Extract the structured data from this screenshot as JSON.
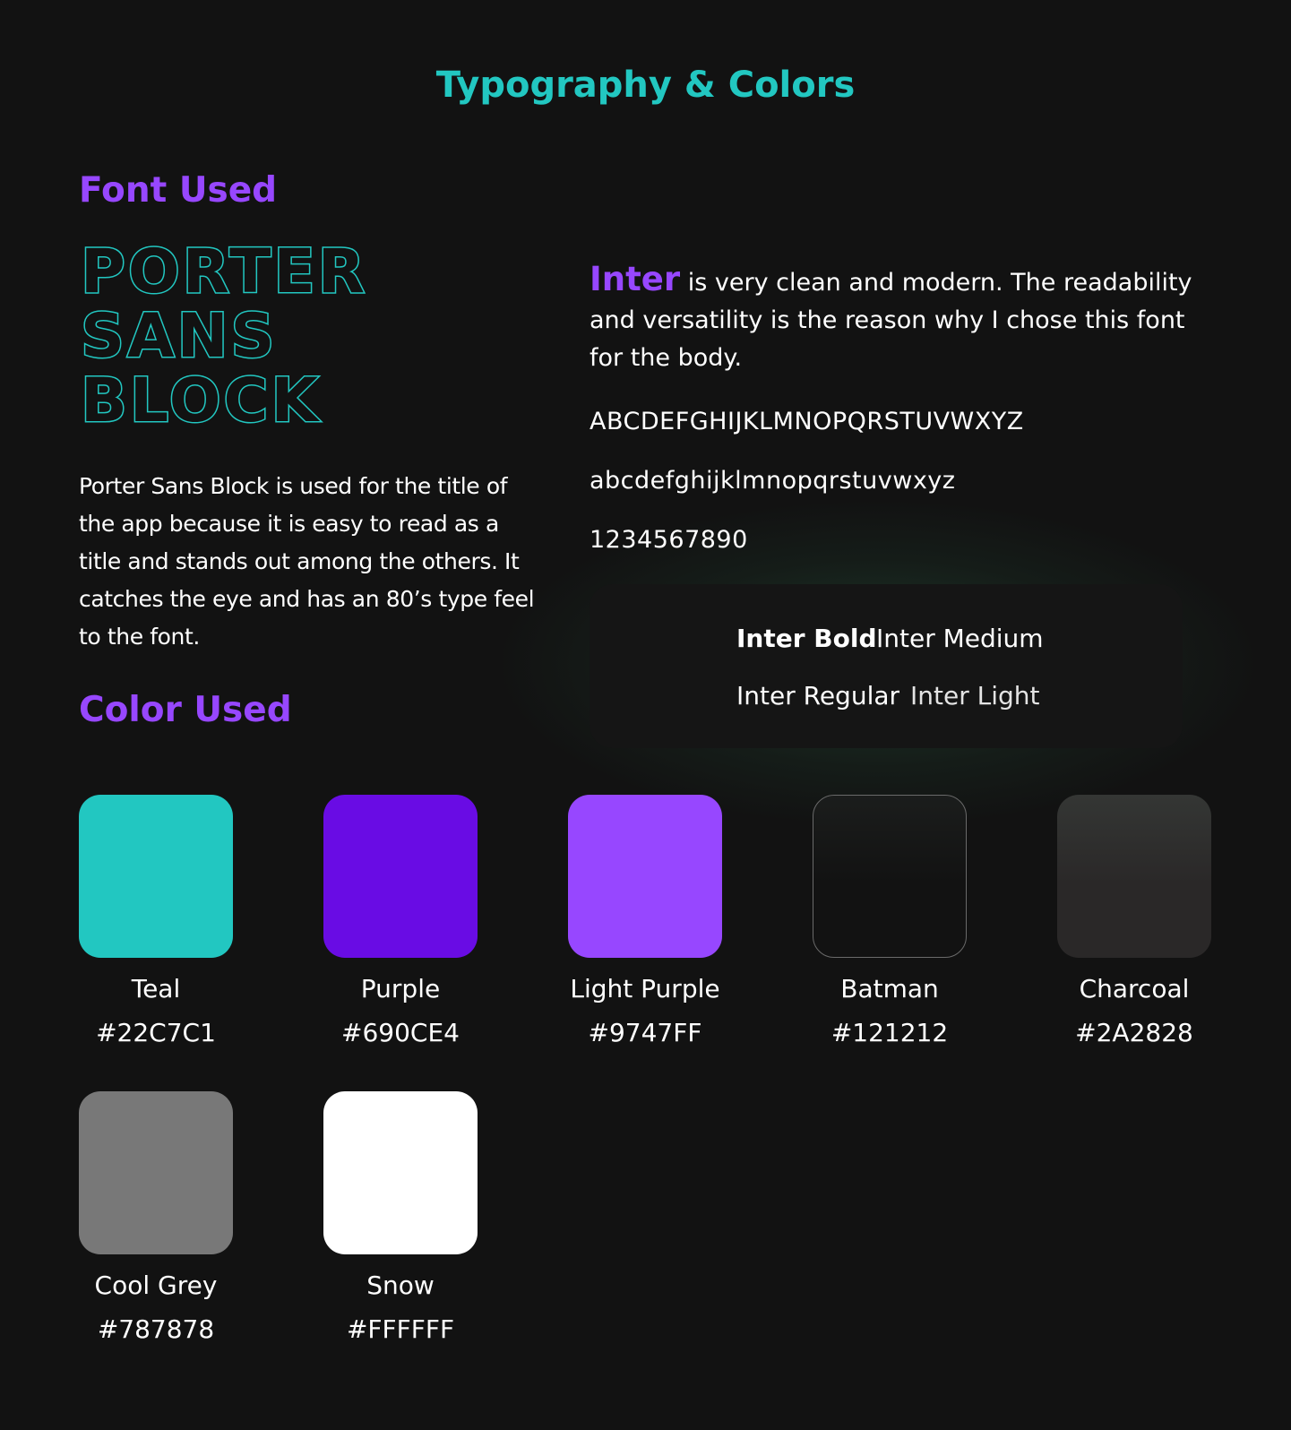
{
  "page": {
    "title": "Typography & Colors"
  },
  "font_section": {
    "heading": "Font Used",
    "display_font": {
      "lines": [
        "PORTER",
        "SANS",
        "BLOCK"
      ],
      "description": "Porter Sans Block is used for the title of the app because it is easy to read as a title and stands out among the others. It catches the eye and has an 80’s type feel to the font."
    },
    "body_font": {
      "name": "Inter",
      "description": " is very clean and modern. The readability and versatility is the reason why I chose this font for the body.",
      "uppercase": "ABCDEFGHIJKLMNOPQRSTUVWXYZ",
      "lowercase": "abcdefghijklmnopqrstuvwxyz",
      "digits": "1234567890",
      "weights": [
        "Inter Bold",
        "Inter Medium",
        "Inter Regular",
        "Inter Light"
      ]
    }
  },
  "color_section": {
    "heading": "Color Used",
    "colors": [
      {
        "name": "Teal",
        "hex": "#22C7C1"
      },
      {
        "name": "Purple",
        "hex": "#690CE4"
      },
      {
        "name": "Light Purple",
        "hex": "#9747FF"
      },
      {
        "name": "Batman",
        "hex": "#121212"
      },
      {
        "name": "Charcoal",
        "hex": "#2A2828"
      },
      {
        "name": "Cool Grey",
        "hex": "#787878"
      },
      {
        "name": "Snow",
        "hex": "#FFFFFF"
      }
    ]
  },
  "theme": {
    "background": "#121212",
    "accent_teal": "#22C7C1",
    "accent_purple": "#9747FF"
  }
}
